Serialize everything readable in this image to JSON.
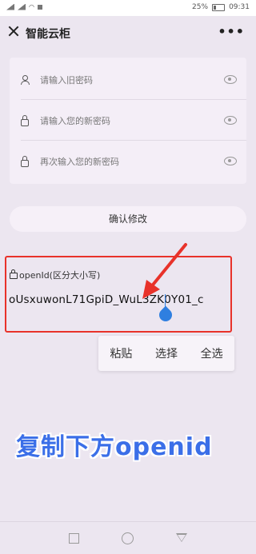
{
  "status_bar": {
    "carrier_icons": "signal-wifi-icons",
    "battery_text": "25%",
    "time": "09:31"
  },
  "header": {
    "title": "智能云柜"
  },
  "form": {
    "old_password_placeholder": "请输入旧密码",
    "new_password_placeholder": "请输入您的新密码",
    "confirm_password_placeholder": "再次输入您的新密码"
  },
  "confirm_button": "确认修改",
  "openid": {
    "label": "openId(区分大小写)",
    "value": "oUsxuwonL71GpiD_WuL3ZK0Y01_c"
  },
  "context_menu": {
    "paste": "粘贴",
    "select": "选择",
    "select_all": "全选"
  },
  "overlay_caption": "复制下方openid",
  "colors": {
    "highlight_border": "#e8322a",
    "caret": "#2f7fe0",
    "caption": "#3b6fe8"
  }
}
